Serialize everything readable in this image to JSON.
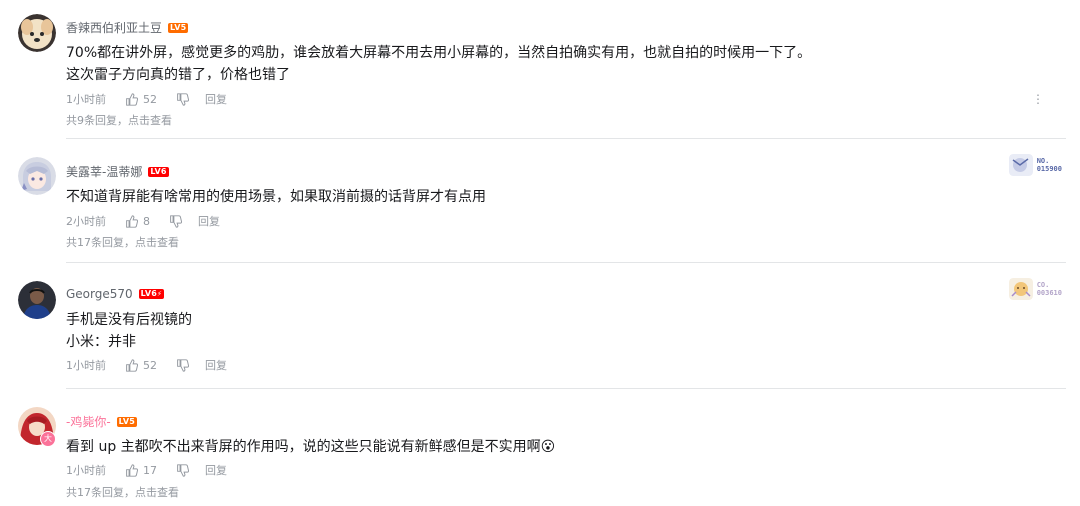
{
  "comments": [
    {
      "username": "香辣西伯利亚土豆",
      "level": "LV5",
      "text_lines": [
        "70%都在讲外屏，感觉更多的鸡肋，谁会放着大屏幕不用去用小屏幕的，当然自拍确实有用，也就自拍的时候用一下了。",
        "这次雷子方向真的错了，价格也错了"
      ],
      "time": "1小时前",
      "likes": "52",
      "reply_label": "回复",
      "replies_text": "共9条回复，点击查看",
      "more_icon": "⋮"
    },
    {
      "username": "美露莘-温蒂娜",
      "level": "LV6",
      "text_lines": [
        "不知道背屏能有啥常用的使用场景，如果取消前摄的话背屏才有点用"
      ],
      "time": "2小时前",
      "likes": "8",
      "reply_label": "回复",
      "replies_text": "共17条回复，点击查看",
      "badge": [
        "NO.",
        "015900"
      ],
      "badge_color": "#5a6aa8"
    },
    {
      "username": "George570",
      "level": "LV6",
      "level_flag": "⚡",
      "text_lines": [
        "手机是没有后视镜的",
        "小米：并非"
      ],
      "time": "1小时前",
      "likes": "52",
      "reply_label": "回复",
      "badge": [
        "CO.",
        "003610"
      ],
      "badge_color": "#b3a5c9"
    },
    {
      "username": "-鸡毙你-",
      "level": "LV5",
      "text_lines": [
        "看到 up 主都吹不出来背屏的作用吗，说的这些只能说有新鲜感但是不实用啊😮"
      ],
      "time": "1小时前",
      "likes": "17",
      "reply_label": "回复",
      "replies_text": "共17条回复，点击查看",
      "avatar_badge": "大"
    }
  ]
}
